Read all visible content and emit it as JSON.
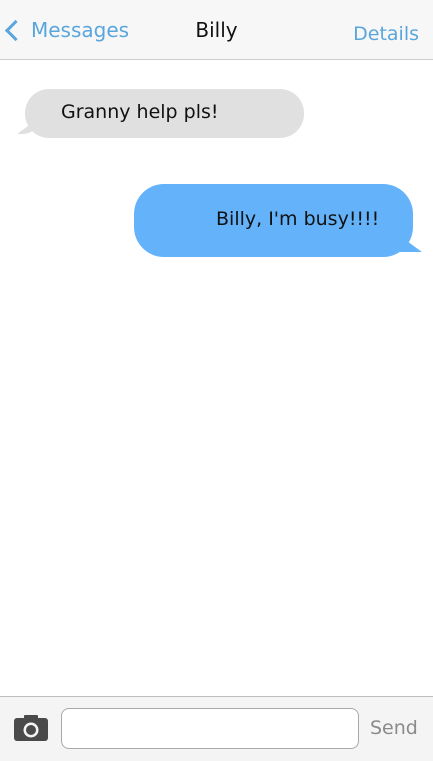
{
  "header": {
    "back_label": "Messages",
    "title": "Billy",
    "details_label": "Details"
  },
  "messages": [
    {
      "direction": "incoming",
      "text": "Granny help pls!"
    },
    {
      "direction": "outgoing",
      "text": "Billy, I'm busy!!!!"
    }
  ],
  "composer": {
    "input_value": "",
    "send_label": "Send",
    "camera_icon": "camera-icon"
  },
  "colors": {
    "accent": "#5aa6dc",
    "incoming_bubble": "#e0e0e0",
    "outgoing_bubble": "#64b3fa"
  }
}
